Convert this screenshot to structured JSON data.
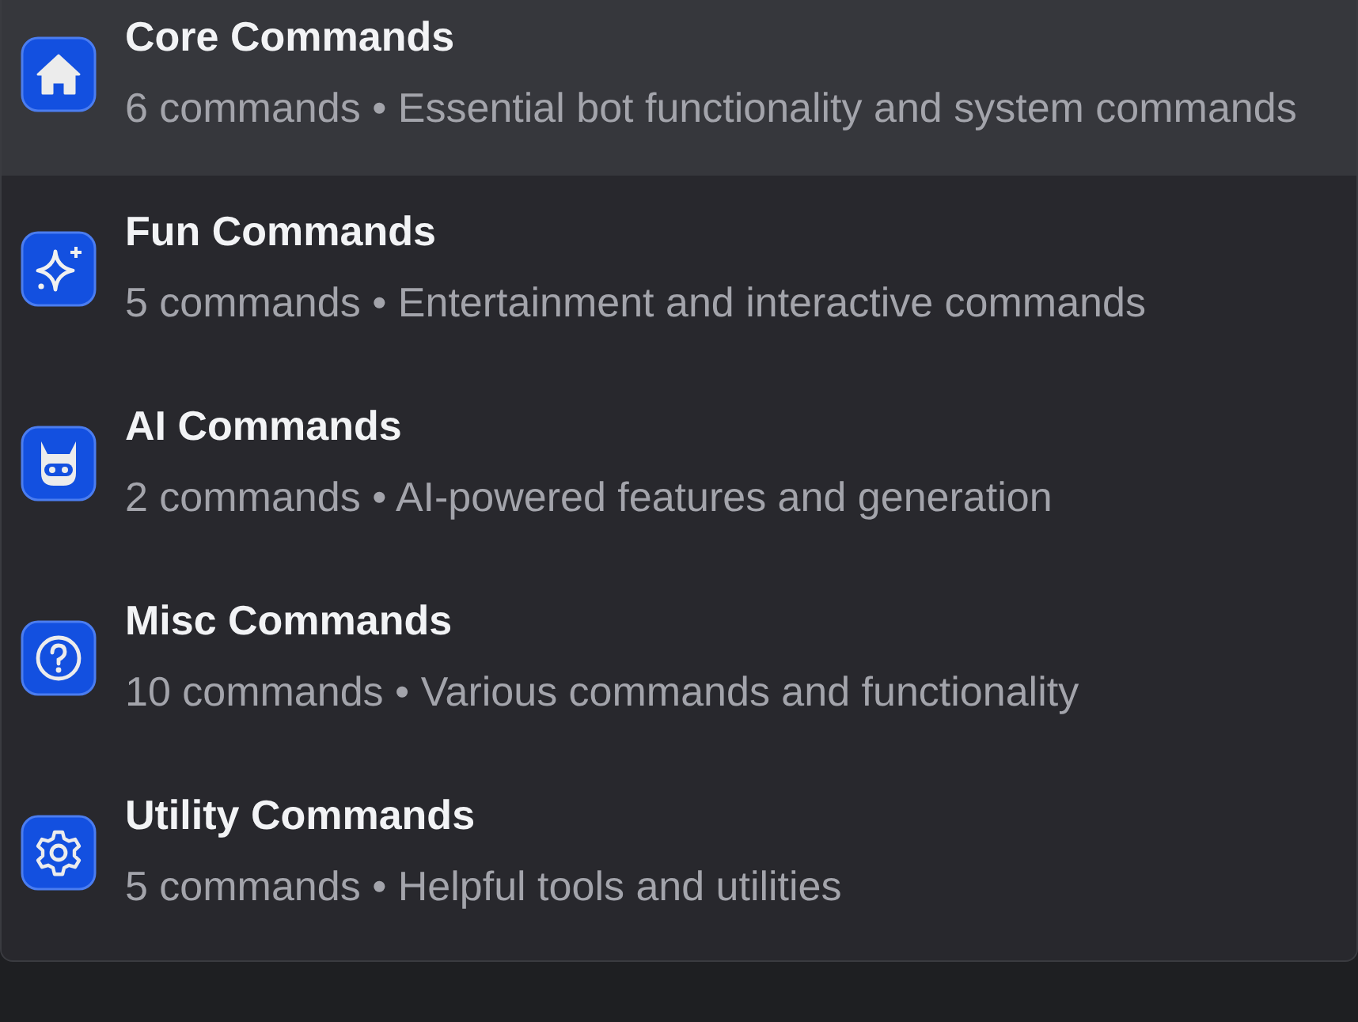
{
  "categories": [
    {
      "kind": "home",
      "title": "Core Commands",
      "description": "6 commands • Essential bot functionality and system commands",
      "selected": true
    },
    {
      "kind": "sparkle",
      "title": "Fun Commands",
      "description": "5 commands • Entertainment and interactive commands",
      "selected": false
    },
    {
      "kind": "robot",
      "title": "AI Commands",
      "description": "2 commands • AI-powered features and generation",
      "selected": false
    },
    {
      "kind": "question",
      "title": "Misc Commands",
      "description": "10 commands • Various commands and functionality",
      "selected": false
    },
    {
      "kind": "gear",
      "title": "Utility Commands",
      "description": "5 commands • Helpful tools and utilities",
      "selected": false
    }
  ]
}
